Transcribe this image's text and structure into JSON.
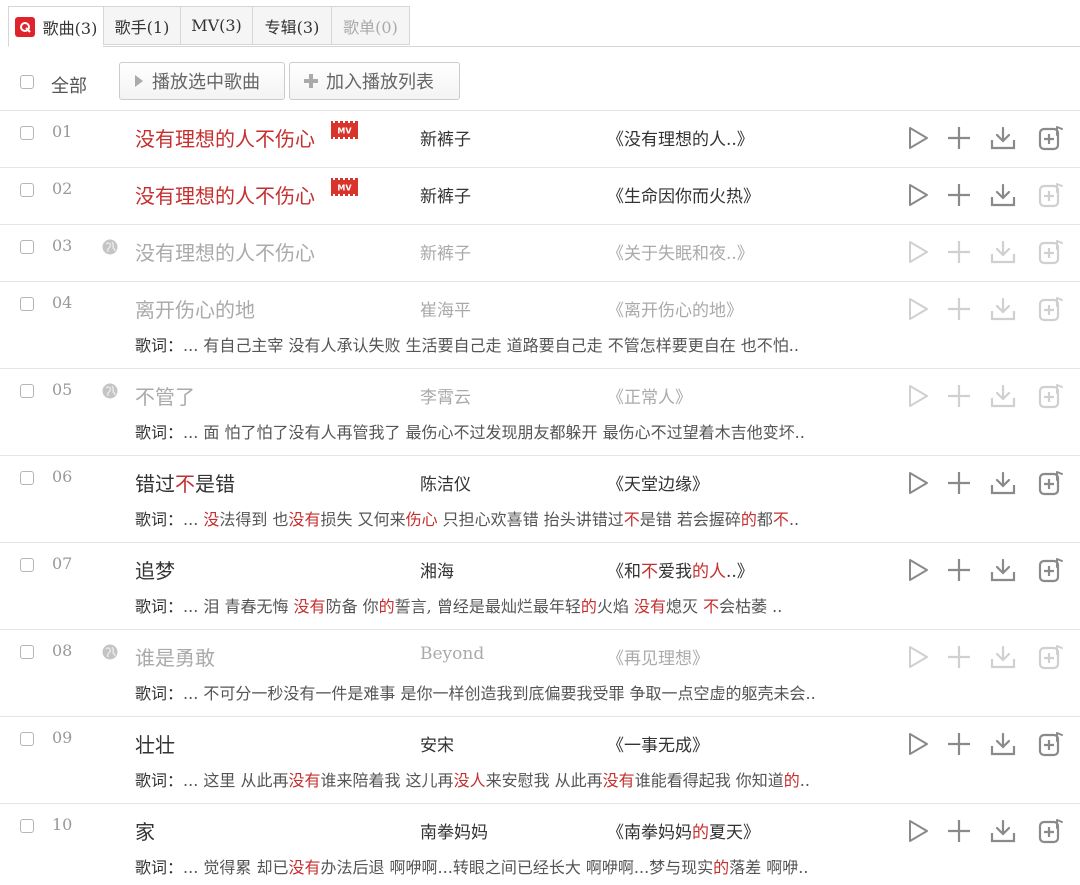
{
  "tabs": [
    {
      "label": "歌曲(3)",
      "active": true
    },
    {
      "label": "歌手(1)",
      "active": false
    },
    {
      "label": "MV(3)",
      "active": false
    },
    {
      "label": "专辑(3)",
      "active": false
    },
    {
      "label": "歌单(0)",
      "disabled": true
    }
  ],
  "toolbar": {
    "select_all_label": "全部",
    "play_selected_label": "播放选中歌曲",
    "add_to_playlist_label": "加入播放列表"
  },
  "lyric_label": "歌词：",
  "colors": {
    "accent": "#c62f2f",
    "brand": "#e0232a",
    "dim": "#aaaaaa"
  },
  "songs": [
    {
      "num": "01",
      "title": "没有理想的人不伤心",
      "artist": "新裤子",
      "album": "《没有理想的人..》",
      "title_style": "red",
      "mv": true,
      "globe": false,
      "dim": false,
      "lyric": null,
      "add_dim": false
    },
    {
      "num": "02",
      "title": "没有理想的人不伤心",
      "artist": "新裤子",
      "album": "《生命因你而火热》",
      "title_style": "red",
      "mv": true,
      "globe": false,
      "dim": false,
      "lyric": null,
      "add_dim": true
    },
    {
      "num": "03",
      "title": "没有理想的人不伤心",
      "artist": "新裤子",
      "album": "《关于失眠和夜..》",
      "title_style": "dim",
      "mv": false,
      "globe": true,
      "dim": true,
      "lyric": null
    },
    {
      "num": "04",
      "title": "离开伤心的地",
      "artist": "崔海平",
      "album": "《离开伤心的地》",
      "title_style": "dim",
      "mv": false,
      "globe": false,
      "dim": true,
      "lyric": [
        {
          "t": "... 有自己主宰 没有人承认失败 生活要自己走 道路要自己走 不管怎样要更自在 也不怕.."
        }
      ]
    },
    {
      "num": "05",
      "title": "不管了",
      "artist": "李霄云",
      "album": "《正常人》",
      "title_style": "dim",
      "mv": false,
      "globe": true,
      "dim": true,
      "lyric": [
        {
          "t": "... 面 怕了怕了没有人再管我了 最伤心不过发现朋友都躲开 最伤心不过望着木吉他变坏.."
        }
      ]
    },
    {
      "num": "06",
      "title_parts": [
        {
          "t": "错过"
        },
        {
          "t": "不",
          "h": true
        },
        {
          "t": "是错"
        }
      ],
      "title": "错过不是错",
      "artist": "陈洁仪",
      "album": "《天堂边缘》",
      "title_style": "normal",
      "mv": false,
      "globe": false,
      "dim": false,
      "lyric": [
        {
          "t": "... "
        },
        {
          "t": "没",
          "h": true
        },
        {
          "t": "法得到 也"
        },
        {
          "t": "没有",
          "h": true
        },
        {
          "t": "损失 又何来"
        },
        {
          "t": "伤心",
          "h": true
        },
        {
          "t": " 只担心欢喜错 抬头讲错过"
        },
        {
          "t": "不",
          "h": true
        },
        {
          "t": "是错 若会握碎"
        },
        {
          "t": "的",
          "h": true
        },
        {
          "t": "都"
        },
        {
          "t": "不",
          "h": true
        },
        {
          "t": ".."
        }
      ]
    },
    {
      "num": "07",
      "title": "追梦",
      "artist": "湘海",
      "album_parts": [
        {
          "t": "《和"
        },
        {
          "t": "不",
          "h": true
        },
        {
          "t": "爱我"
        },
        {
          "t": "的人",
          "h": true
        },
        {
          "t": "..》"
        }
      ],
      "album": "《和不爱我的人..》",
      "title_style": "normal",
      "mv": false,
      "globe": false,
      "dim": false,
      "lyric": [
        {
          "t": "... 泪 青春无悔 "
        },
        {
          "t": "没有",
          "h": true
        },
        {
          "t": "防备 你"
        },
        {
          "t": "的",
          "h": true
        },
        {
          "t": "誓言, 曾经是最灿烂最年轻"
        },
        {
          "t": "的",
          "h": true
        },
        {
          "t": "火焰 "
        },
        {
          "t": "没有",
          "h": true
        },
        {
          "t": "熄灭 "
        },
        {
          "t": "不",
          "h": true
        },
        {
          "t": "会枯萎 .."
        }
      ]
    },
    {
      "num": "08",
      "title": "谁是勇敢",
      "artist": "Beyond",
      "album": "《再见理想》",
      "title_style": "dim",
      "mv": false,
      "globe": true,
      "dim": true,
      "lyric": [
        {
          "t": "... 不可分一秒没有一件是难事 是你一样创造我到底偏要我受罪 争取一点空虚的躯壳未会.."
        }
      ]
    },
    {
      "num": "09",
      "title": "壮壮",
      "artist": "安宋",
      "album": "《一事无成》",
      "title_style": "normal",
      "mv": false,
      "globe": false,
      "dim": false,
      "lyric": [
        {
          "t": "... 这里 从此再"
        },
        {
          "t": "没有",
          "h": true
        },
        {
          "t": "谁来陪着我 这儿再"
        },
        {
          "t": "没人",
          "h": true
        },
        {
          "t": "来安慰我 从此再"
        },
        {
          "t": "没有",
          "h": true
        },
        {
          "t": "谁能看得起我 你知道"
        },
        {
          "t": "的",
          "h": true
        },
        {
          "t": ".."
        }
      ]
    },
    {
      "num": "10",
      "title": "家",
      "artist": "南拳妈妈",
      "album_parts": [
        {
          "t": "《南拳妈妈"
        },
        {
          "t": "的",
          "h": true
        },
        {
          "t": "夏天》"
        }
      ],
      "album": "《南拳妈妈的夏天》",
      "title_style": "normal",
      "mv": false,
      "globe": false,
      "dim": false,
      "lyric": [
        {
          "t": "... 觉得累 却已"
        },
        {
          "t": "没有",
          "h": true
        },
        {
          "t": "办法后退 啊咿啊...转眼之间已经长大 啊咿啊...梦与现实"
        },
        {
          "t": "的",
          "h": true
        },
        {
          "t": "落差 啊咿.."
        }
      ]
    }
  ]
}
